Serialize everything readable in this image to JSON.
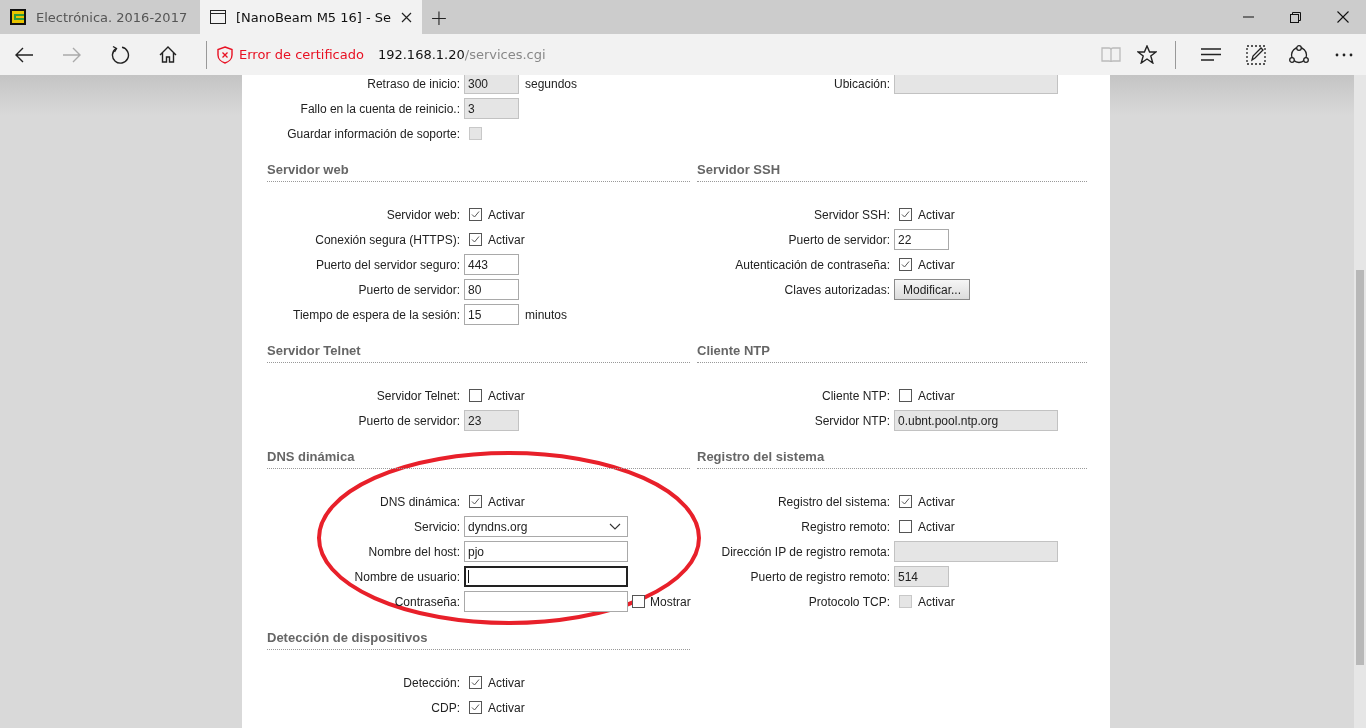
{
  "browser": {
    "tabs": [
      {
        "title": "Electrónica. 2016-2017",
        "selected": false,
        "closable": false
      },
      {
        "title": "[NanoBeam M5 16] - Se",
        "selected": true,
        "closable": true
      }
    ],
    "new_tab": "+",
    "toolbar": {
      "forward_disabled": true,
      "reading_view_disabled": true
    },
    "address": {
      "security": "Error de certificado",
      "host": "192.168.1.20",
      "path": "/services.cgi"
    }
  },
  "section_rows": [
    {
      "sections": [
        {
          "rows": [
            {
              "kind": "input",
              "label": "Retraso de inicio:",
              "value": "300",
              "disabled": true,
              "wide": false,
              "suffix": "segundos"
            },
            {
              "kind": "input",
              "label": "Fallo en la cuenta de reinicio.:",
              "value": "3",
              "disabled": true,
              "wide": false
            },
            {
              "kind": "checkbox",
              "label": "Guardar información de soporte:",
              "checked": false,
              "disabled": true
            }
          ]
        },
        {
          "rows": [
            {
              "kind": "input",
              "label": "Ubicación:",
              "disabled": true,
              "wide": true
            }
          ]
        }
      ]
    },
    {
      "sections": [
        {
          "title": "Servidor web",
          "rows": [
            {
              "kind": "checkbox",
              "label": "Servidor web:",
              "checked": true,
              "disabled": false,
              "text": "Activar"
            },
            {
              "kind": "checkbox",
              "label": "Conexión segura (HTTPS):",
              "checked": true,
              "disabled": false,
              "text": "Activar"
            },
            {
              "kind": "input",
              "label": "Puerto del servidor seguro:",
              "value": "443",
              "disabled": false,
              "wide": false
            },
            {
              "kind": "input",
              "label": "Puerto de servidor:",
              "value": "80",
              "disabled": false,
              "wide": false
            },
            {
              "kind": "input",
              "label": "Tiempo de espera de la sesión:",
              "value": "15",
              "disabled": false,
              "wide": false,
              "suffix": "minutos"
            }
          ]
        },
        {
          "title": "Servidor SSH",
          "rows": [
            {
              "kind": "checkbox",
              "label": "Servidor SSH:",
              "checked": true,
              "disabled": false,
              "text": "Activar"
            },
            {
              "kind": "input",
              "label": "Puerto de servidor:",
              "value": "22",
              "disabled": false,
              "wide": false
            },
            {
              "kind": "checkbox",
              "label": "Autenticación de contraseña:",
              "checked": true,
              "disabled": false,
              "text": "Activar"
            },
            {
              "kind": "button",
              "label": "Claves autorizadas:",
              "text": "Modificar..."
            }
          ]
        }
      ]
    },
    {
      "sections": [
        {
          "title": "Servidor Telnet",
          "rows": [
            {
              "kind": "checkbox",
              "label": "Servidor Telnet:",
              "checked": false,
              "disabled": false,
              "text": "Activar"
            },
            {
              "kind": "input",
              "label": "Puerto de servidor:",
              "value": "23",
              "disabled": true,
              "wide": false
            }
          ]
        },
        {
          "title": "Cliente NTP",
          "rows": [
            {
              "kind": "checkbox",
              "label": "Cliente NTP:",
              "checked": false,
              "disabled": false,
              "text": "Activar"
            },
            {
              "kind": "input",
              "label": "Servidor NTP:",
              "value": "0.ubnt.pool.ntp.org",
              "disabled": true,
              "wide": true
            }
          ]
        }
      ]
    },
    {
      "sections": [
        {
          "title": "DNS dinámica",
          "rows": [
            {
              "kind": "checkbox",
              "label": "DNS dinámica:",
              "checked": true,
              "disabled": false,
              "text": "Activar"
            },
            {
              "kind": "select",
              "label": "Servicio:",
              "value": "dyndns.org"
            },
            {
              "kind": "input",
              "label": "Nombre del host:",
              "value": "pjo",
              "disabled": false,
              "wide": true
            },
            {
              "kind": "input",
              "label": "Nombre de usuario:",
              "disabled": false,
              "wide": true,
              "focused": true
            },
            {
              "kind": "input",
              "label": "Contraseña:",
              "disabled": false,
              "wide": true,
              "toggle": {
                "text": "Mostrar",
                "checked": false
              }
            }
          ]
        },
        {
          "title": "Registro del sistema",
          "rows": [
            {
              "kind": "checkbox",
              "label": "Registro del sistema:",
              "checked": true,
              "disabled": false,
              "text": "Activar"
            },
            {
              "kind": "checkbox",
              "label": "Registro remoto:",
              "checked": false,
              "disabled": false,
              "text": "Activar"
            },
            {
              "kind": "input",
              "label": "Dirección IP de registro remota:",
              "disabled": true,
              "wide": true
            },
            {
              "kind": "input",
              "label": "Puerto de registro remoto:",
              "value": "514",
              "disabled": true,
              "wide": false
            },
            {
              "kind": "checkbox",
              "label": "Protocolo TCP:",
              "checked": false,
              "disabled": true,
              "text": "Activar"
            }
          ]
        }
      ]
    },
    {
      "sections": [
        {
          "title": "Detección de dispositivos",
          "rows": [
            {
              "kind": "checkbox",
              "label": "Detección:",
              "checked": true,
              "disabled": false,
              "text": "Activar"
            },
            {
              "kind": "checkbox",
              "label": "CDP:",
              "checked": true,
              "disabled": false,
              "text": "Activar"
            }
          ]
        }
      ]
    }
  ],
  "annotation": {
    "kind": "ellipse",
    "color": "#e8202a"
  }
}
